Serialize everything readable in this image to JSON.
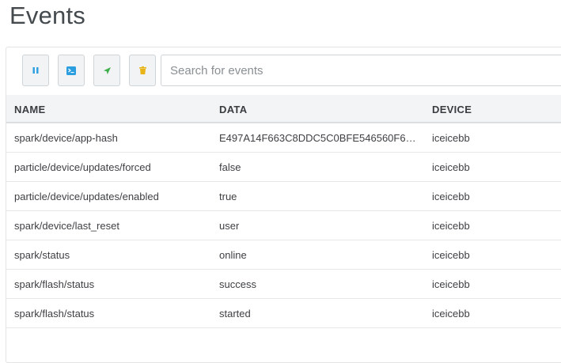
{
  "page": {
    "title": "Events"
  },
  "toolbar": {
    "buttons": [
      {
        "name": "pause-button",
        "icon": "pause-icon",
        "color": "#2b9ee0"
      },
      {
        "name": "terminal-button",
        "icon": "terminal-icon",
        "color": "#2b9ee0"
      },
      {
        "name": "publish-button",
        "icon": "send-icon",
        "color": "#3cae4a"
      },
      {
        "name": "clear-button",
        "icon": "trash-icon",
        "color": "#e8b417"
      }
    ]
  },
  "search": {
    "placeholder": "Search for events",
    "value": ""
  },
  "table": {
    "columns": [
      "NAME",
      "DATA",
      "DEVICE"
    ],
    "rows": [
      {
        "name": "spark/device/app-hash",
        "data": "E497A14F663C8DDC5C0BFE546560F6…",
        "device": "iceicebb"
      },
      {
        "name": "particle/device/updates/forced",
        "data": "false",
        "device": "iceicebb"
      },
      {
        "name": "particle/device/updates/enabled",
        "data": "true",
        "device": "iceicebb"
      },
      {
        "name": "spark/device/last_reset",
        "data": "user",
        "device": "iceicebb"
      },
      {
        "name": "spark/status",
        "data": "online",
        "device": "iceicebb"
      },
      {
        "name": "spark/flash/status",
        "data": "success",
        "device": "iceicebb"
      },
      {
        "name": "spark/flash/status",
        "data": "started",
        "device": "iceicebb"
      }
    ]
  }
}
